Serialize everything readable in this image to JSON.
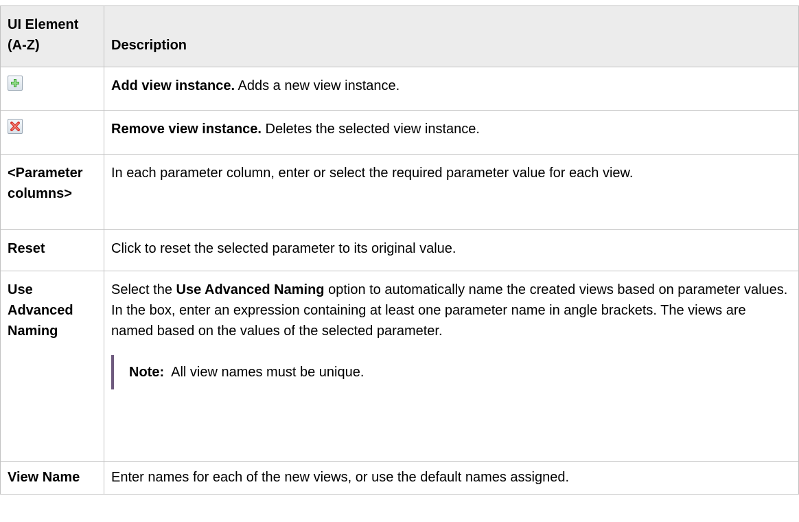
{
  "table": {
    "headers": {
      "element": "UI Element (A-Z)",
      "description": "Description"
    },
    "rows": {
      "add": {
        "element_icon": "add-icon",
        "desc_bold": "Add view instance.",
        "desc_text": " Adds a new view instance."
      },
      "remove": {
        "element_icon": "remove-icon",
        "desc_bold": "Remove view instance.",
        "desc_text": " Deletes the selected view instance."
      },
      "parameter_columns": {
        "element": "<Parameter columns>",
        "desc_text": "In each parameter column, enter or select the required parameter value for each view."
      },
      "reset": {
        "element": "Reset",
        "desc_text": "Click to reset the selected parameter to its original value."
      },
      "advanced_naming": {
        "element": "Use Advanced Naming",
        "desc_prefix": "Select the ",
        "desc_bold": "Use Advanced Naming",
        "desc_suffix": " option to automatically name the created views based on parameter values. In the box, enter an expression containing at least one parameter name in angle brackets. The views are named based on the values of the selected parameter.",
        "note_label": "Note:",
        "note_text": "  All view names must be unique."
      },
      "view_name": {
        "element": "View Name",
        "desc_text": "Enter names for each of the new views, or use the default names assigned."
      }
    }
  },
  "colors": {
    "header_bg": "#ececec",
    "border": "#c2c2c2",
    "note_bar": "#6e5a7e",
    "add_icon": "#3ca335",
    "remove_icon": "#d8342c"
  }
}
